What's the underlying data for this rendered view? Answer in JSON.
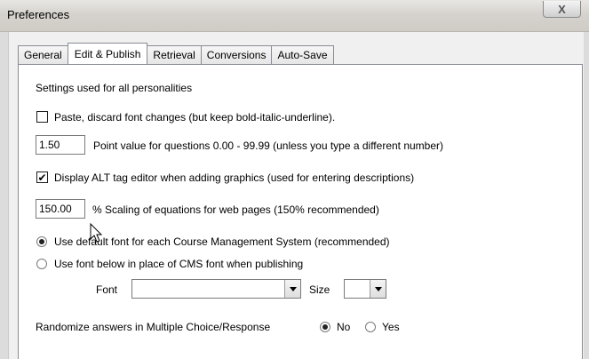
{
  "window": {
    "title": "Preferences",
    "close_label": "X"
  },
  "tabs": [
    {
      "label": "General"
    },
    {
      "label": "Edit & Publish"
    },
    {
      "label": "Retrieval"
    },
    {
      "label": "Conversions"
    },
    {
      "label": "Auto-Save"
    }
  ],
  "panel": {
    "heading": "Settings used for all personalities",
    "paste": {
      "checked": false,
      "label": "Paste, discard font changes (but keep bold-italic-underline)."
    },
    "point_value": {
      "value": "1.50",
      "label": "Point value for questions 0.00 - 99.99  (unless you type a different number)"
    },
    "alt_tag": {
      "checked": true,
      "label": "Display ALT tag editor when adding graphics (used for entering descriptions)"
    },
    "scaling": {
      "value": "150.00",
      "label": "%  Scaling of equations for web pages (150% recommended)"
    },
    "font_mode": {
      "selected": "default",
      "options": [
        "Use default font for each Course Management System (recommended)",
        "Use font below in place of CMS font when publishing"
      ]
    },
    "font": {
      "label": "Font",
      "value": ""
    },
    "size": {
      "label": "Size",
      "value": ""
    },
    "randomize": {
      "label": "Randomize answers in Multiple Choice/Response",
      "selected": "No",
      "options": [
        "No",
        "Yes"
      ]
    }
  }
}
